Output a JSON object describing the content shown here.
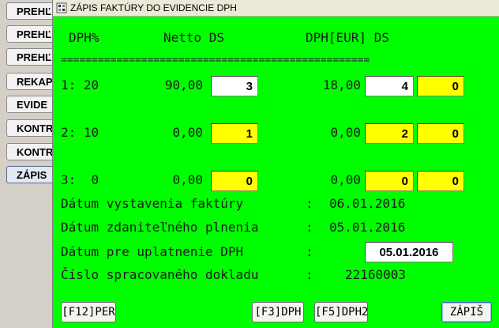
{
  "left_menu": [
    "PREHĽ",
    "PREHĽ",
    "PREHĽ",
    "REKAP",
    "EVIDE",
    "KONTR",
    "KONTR",
    "ZÁPIS"
  ],
  "dialog": {
    "title": "ZÁPIS FAKTÚRY DO EVIDENCIE DPH",
    "header": {
      "dph_pct": "DPH%",
      "netto": "Netto DS",
      "dph_eur": "DPH[EUR] DS"
    },
    "separator": "==================================================",
    "rows": [
      {
        "label": "1: 20",
        "netto_value": "90,00",
        "field1": "3",
        "dph_value": "18,00",
        "field2": "4",
        "field3": "0"
      },
      {
        "label": "2: 10",
        "netto_value": "0,00",
        "field1": "1",
        "dph_value": "0,00",
        "field2": "2",
        "field3": "0"
      },
      {
        "label": "3:  0",
        "netto_value": "0,00",
        "field1": "0",
        "dph_value": "0,00",
        "field2": "0",
        "field3": "0"
      }
    ],
    "info": [
      {
        "label": "Dátum vystavenia faktúry",
        "colon": ":",
        "value": "06.01.2016"
      },
      {
        "label": "Dátum zdaniteľného plnenia",
        "colon": ":",
        "value": "05.01.2016"
      },
      {
        "label": "Dátum pre uplatnenie DPH",
        "colon": ":",
        "value": "05.01.2016"
      },
      {
        "label": "Číslo spracovaného dokladu",
        "colon": ":",
        "value": "22160003"
      }
    ],
    "buttons": {
      "per": "[F12]PER",
      "dph": "[F3]DPH",
      "dph2": "[F5]DPH2",
      "zapis": "ZÁPIŠ"
    }
  }
}
